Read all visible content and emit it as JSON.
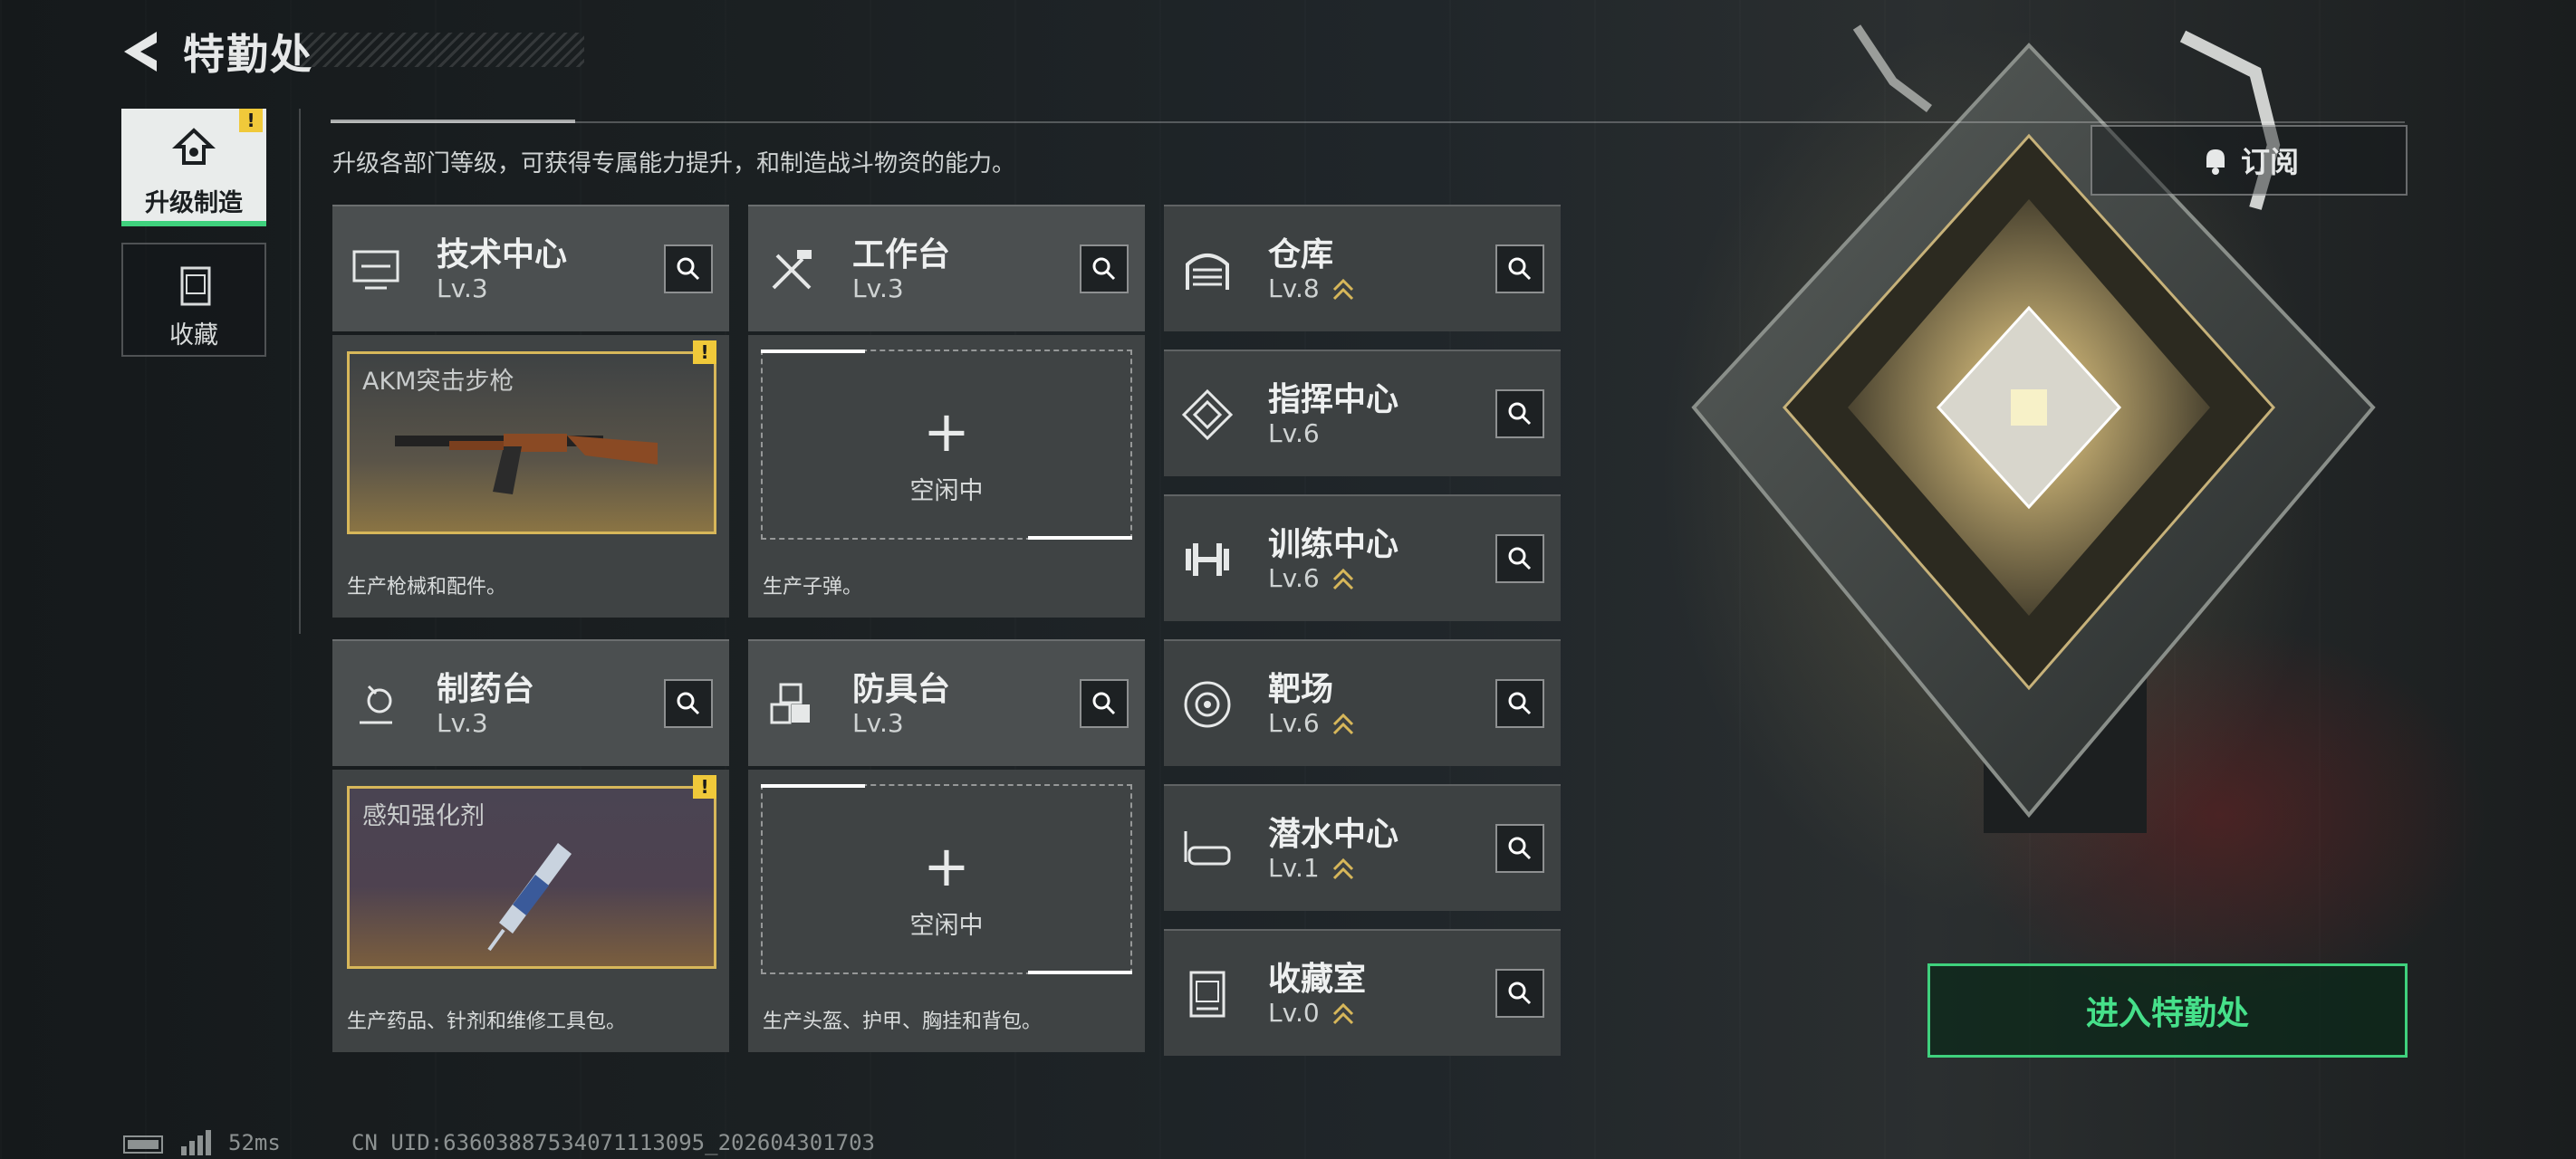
{
  "header": {
    "title": "特勤处"
  },
  "description": "升级各部门等级，可获得专属能力提升，和制造战斗物资的能力。",
  "nav": [
    {
      "label": "升级制造",
      "active": true,
      "icon": "upgrade-icon",
      "alert": "!"
    },
    {
      "label": "收藏",
      "active": false,
      "icon": "collection-icon"
    }
  ],
  "columns": {
    "col1": [
      {
        "name": "技术中心",
        "level": "Lv.3",
        "icon": "tech-center-icon"
      },
      {
        "name": "制药台",
        "level": "Lv.3",
        "icon": "pharmacy-icon"
      }
    ],
    "col2": [
      {
        "name": "工作台",
        "level": "Lv.3",
        "icon": "workbench-icon"
      },
      {
        "name": "防具台",
        "level": "Lv.3",
        "icon": "armor-bench-icon"
      }
    ],
    "col3": [
      {
        "name": "仓库",
        "level": "Lv.8",
        "icon": "warehouse-icon",
        "upgradable": true
      },
      {
        "name": "指挥中心",
        "level": "Lv.6",
        "icon": "command-center-icon",
        "upgradable": false
      },
      {
        "name": "训练中心",
        "level": "Lv.6",
        "icon": "training-center-icon",
        "upgradable": true
      },
      {
        "name": "靶场",
        "level": "Lv.6",
        "icon": "shooting-range-icon",
        "upgradable": true
      },
      {
        "name": "潜水中心",
        "level": "Lv.1",
        "icon": "diving-center-icon",
        "upgradable": true
      },
      {
        "name": "收藏室",
        "level": "Lv.0",
        "icon": "collection-room-icon",
        "upgradable": true
      }
    ]
  },
  "production": {
    "tech": {
      "item": "AKM突击步枪",
      "text": "生产枪械和配件。",
      "alert": "!"
    },
    "workbench": {
      "status": "空闲中",
      "text": "生产子弹。",
      "plus": "+"
    },
    "pharmacy": {
      "item": "感知强化剂",
      "text": "生产药品、针剂和维修工具包。",
      "alert": "!"
    },
    "armor": {
      "status": "空闲中",
      "text": "生产头盔、护甲、胸挂和背包。",
      "plus": "+"
    }
  },
  "buttons": {
    "subscribe": "订阅",
    "enter": "进入特勤处"
  },
  "footer": {
    "ping": "52ms",
    "uid": "CN UID:636038875340711130​95_202604301703"
  },
  "colors": {
    "accent_green": "#3fd17d",
    "warning_yellow": "#f0c93a",
    "item_border": "#d7b75a"
  }
}
